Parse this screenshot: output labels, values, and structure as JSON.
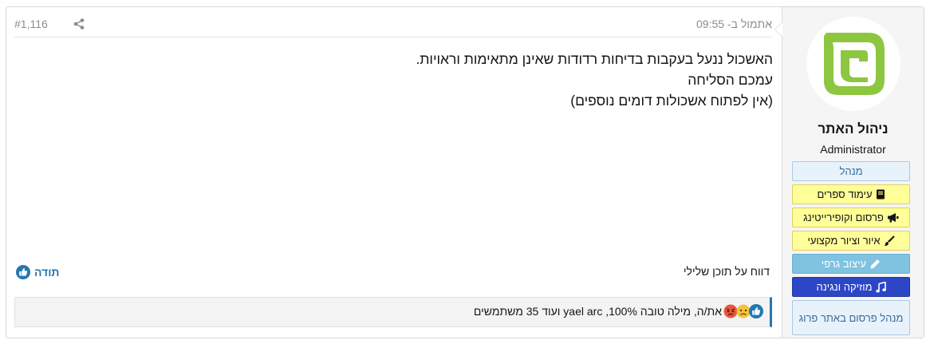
{
  "post": {
    "number": "#1,116",
    "timestamp": "אתמול ב- 09:55",
    "content_lines": [
      "האשכול ננעל בעקבות בדיחות רדודות שאינן מתאימות וראויות.",
      "עמכם הסליחה",
      "(אין לפתוח אשכולות דומים נוספים)"
    ],
    "report_label": "דווח על תוכן שלילי",
    "thanks_label": "תודה",
    "reactions_text": "את/ה, מילה טובה 100%, yael arc ועוד 35 משתמשים",
    "reaction_icons": [
      "like-icon",
      "sad-icon",
      "angry-icon"
    ]
  },
  "user": {
    "name": "ניהול האתר",
    "title": "Administrator",
    "banners": [
      {
        "label": "מנהל",
        "icon": "none"
      },
      {
        "label": "עימוד ספרים",
        "icon": "book-icon"
      },
      {
        "label": "פרסום וקופירייטינג",
        "icon": "megaphone-icon"
      },
      {
        "label": "איור וציור מקצועי",
        "icon": "brush-icon"
      },
      {
        "label": "עיצוב גרפי",
        "icon": "pencil-icon"
      },
      {
        "label": "מוזיקה ונגינה",
        "icon": "music-icon"
      },
      {
        "label": "מנהל פרסום באתר פרוג",
        "icon": "none"
      }
    ]
  },
  "colors": {
    "accent": "#2577b1",
    "logo_green": "#8dc63f",
    "banner_yellow": "#ffff99",
    "banner_music": "#2c46c6",
    "banner_graphic": "#7fc3e0"
  }
}
